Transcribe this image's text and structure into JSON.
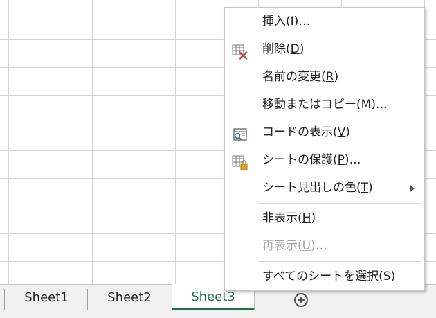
{
  "menu": {
    "items": [
      {
        "name": "insert",
        "pre": "挿入(",
        "key": "I",
        "post": ")…",
        "disabled": false
      },
      {
        "name": "delete",
        "pre": "削除(",
        "key": "D",
        "post": ")",
        "disabled": false,
        "icon": "delete-sheet-icon"
      },
      {
        "name": "rename",
        "pre": "名前の変更(",
        "key": "R",
        "post": ")",
        "disabled": false
      },
      {
        "name": "move-copy",
        "pre": "移動またはコピー(",
        "key": "M",
        "post": ")…",
        "disabled": false
      },
      {
        "name": "view-code",
        "pre": "コードの表示(",
        "key": "V",
        "post": ")",
        "disabled": false,
        "icon": "view-code-icon"
      },
      {
        "name": "protect-sheet",
        "pre": "シートの保護(",
        "key": "P",
        "post": ")…",
        "disabled": false,
        "icon": "protect-sheet-icon"
      },
      {
        "name": "tab-color",
        "pre": "シート見出しの色(",
        "key": "T",
        "post": ")",
        "disabled": false,
        "submenu": true
      },
      {
        "name": "hide",
        "pre": "非表示(",
        "key": "H",
        "post": ")",
        "disabled": false
      },
      {
        "name": "unhide",
        "pre": "再表示(",
        "key": "U",
        "post": ")…",
        "disabled": true
      },
      {
        "name": "select-all-sheets",
        "pre": "すべてのシートを選択(",
        "key": "S",
        "post": ")",
        "disabled": false
      }
    ]
  },
  "tabs": [
    {
      "label": "Sheet1",
      "active": false
    },
    {
      "label": "Sheet2",
      "active": false
    },
    {
      "label": "Sheet3",
      "active": true
    }
  ],
  "colors": {
    "accent": "#217346",
    "disabled": "#a6a6a6",
    "delete_icon": "#c0504d"
  }
}
